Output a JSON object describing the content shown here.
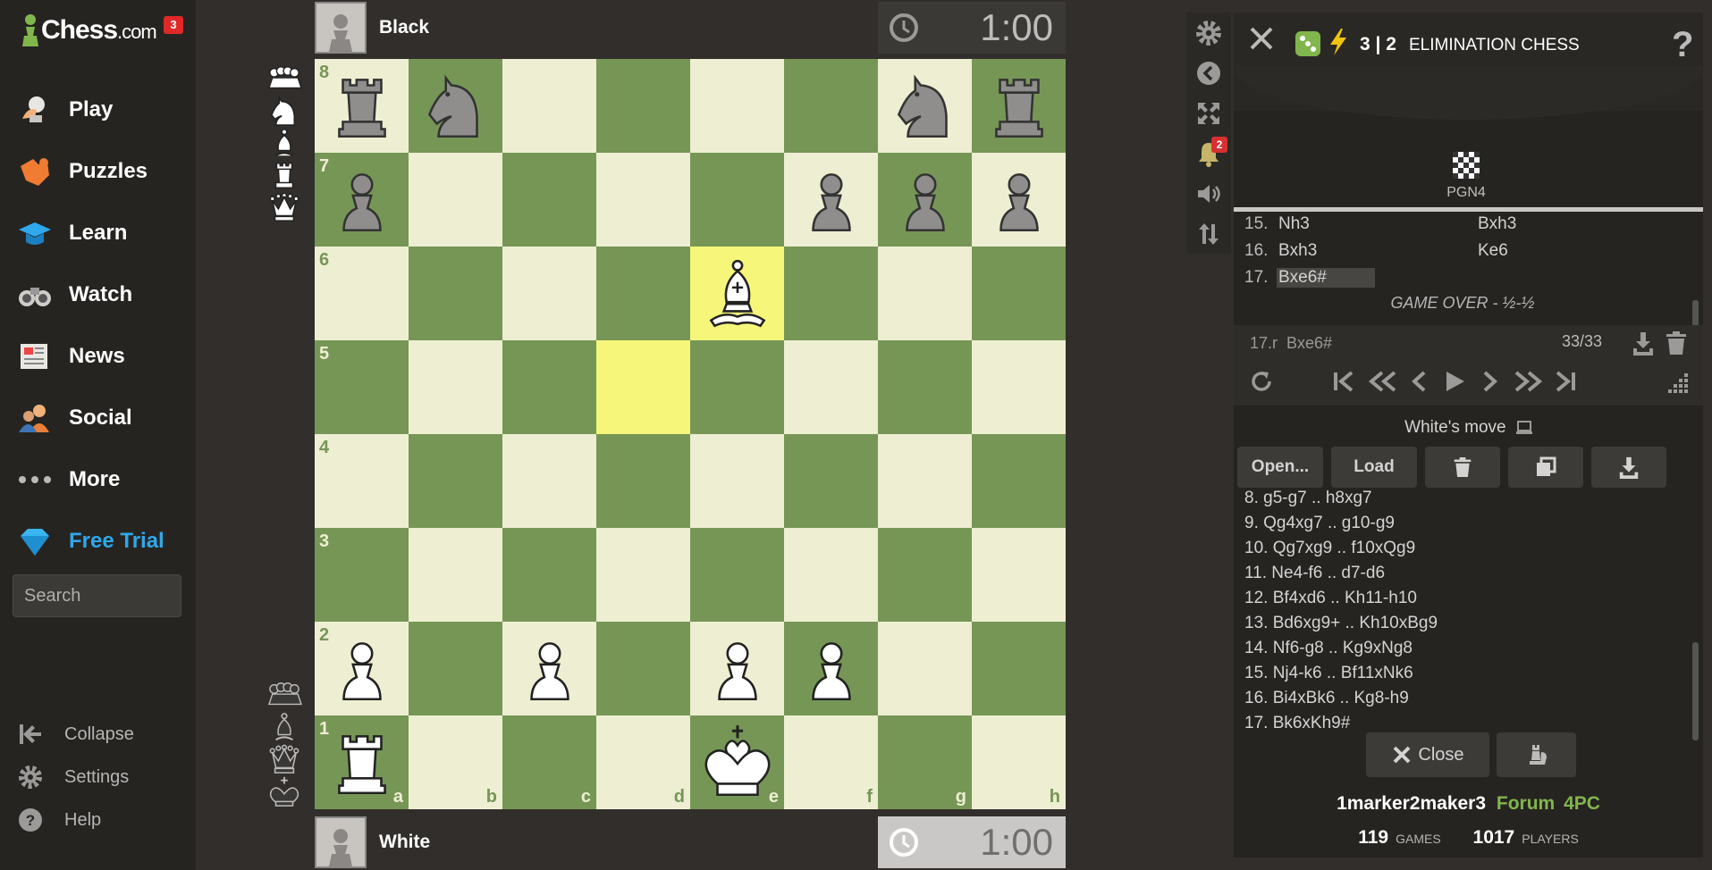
{
  "brand": {
    "name": "Chess",
    "suffix": ".com",
    "badge": "3"
  },
  "nav": [
    {
      "id": "play",
      "label": "Play",
      "icon": "play-hand-icon"
    },
    {
      "id": "puzzles",
      "label": "Puzzles",
      "icon": "puzzle-icon"
    },
    {
      "id": "learn",
      "label": "Learn",
      "icon": "graduation-cap-icon"
    },
    {
      "id": "watch",
      "label": "Watch",
      "icon": "binoculars-icon"
    },
    {
      "id": "news",
      "label": "News",
      "icon": "newspaper-icon"
    },
    {
      "id": "social",
      "label": "Social",
      "icon": "people-icon"
    },
    {
      "id": "more",
      "label": "More",
      "icon": "ellipsis-icon"
    },
    {
      "id": "free-trial",
      "label": "Free Trial",
      "icon": "diamond-icon"
    }
  ],
  "search": {
    "placeholder": "Search"
  },
  "bottom_nav": [
    {
      "id": "collapse",
      "label": "Collapse"
    },
    {
      "id": "settings",
      "label": "Settings"
    },
    {
      "id": "help",
      "label": "Help"
    }
  ],
  "players": {
    "top": {
      "name": "Black",
      "clock": "1:00"
    },
    "bottom": {
      "name": "White",
      "clock": "1:00"
    }
  },
  "board": {
    "ranks": [
      "8",
      "7",
      "6",
      "5",
      "4",
      "3",
      "2",
      "1"
    ],
    "files": [
      "a",
      "b",
      "c",
      "d",
      "e",
      "f",
      "g",
      "h"
    ],
    "highlight_squares": [
      "e6",
      "d5"
    ],
    "pieces": [
      {
        "sq": "a8",
        "p": "bR"
      },
      {
        "sq": "b8",
        "p": "bN"
      },
      {
        "sq": "g8",
        "p": "bN"
      },
      {
        "sq": "h8",
        "p": "bR"
      },
      {
        "sq": "a7",
        "p": "bP"
      },
      {
        "sq": "f7",
        "p": "bP"
      },
      {
        "sq": "g7",
        "p": "bP"
      },
      {
        "sq": "h7",
        "p": "bP"
      },
      {
        "sq": "e6",
        "p": "wB"
      },
      {
        "sq": "a2",
        "p": "wP"
      },
      {
        "sq": "c2",
        "p": "wP"
      },
      {
        "sq": "e2",
        "p": "wP"
      },
      {
        "sq": "f2",
        "p": "wP"
      },
      {
        "sq": "a1",
        "p": "wR"
      },
      {
        "sq": "e1",
        "p": "wK"
      }
    ]
  },
  "captured": {
    "top": [
      "pawns-group",
      "knight",
      "bishop",
      "rook",
      "queen"
    ],
    "bottom": [
      "pawns-group",
      "bishop",
      "queen",
      "king"
    ]
  },
  "panel": {
    "mode_time": "3 | 2",
    "mode_name": "ELIMINATION CHESS",
    "help": "?",
    "tab_label": "PGN4",
    "moves_top": [
      {
        "num": "15.",
        "w": "Nh3",
        "b": "Bxh3"
      },
      {
        "num": "16.",
        "w": "Bxh3",
        "b": "Ke6"
      },
      {
        "num": "17.",
        "w": "Bxe6#",
        "b": ""
      }
    ],
    "game_over": "GAME OVER - ½-½",
    "current_move_num": "17.r",
    "current_move": "Bxe6#",
    "move_count": "33/33",
    "whites_move": "White's move",
    "buttons": {
      "open": "Open...",
      "load": "Load"
    },
    "moves_list": [
      "8. g5-g7 .. h8xg7",
      "9. Qg4xg7 .. g10-g9",
      "10. Qg7xg9 .. f10xQg9",
      "11. Ne4-f6 .. d7-d6",
      "12. Bf4xd6 .. Kh11-h10",
      "13. Bd6xg9+ .. Kh10xBg9",
      "14. Nf6-g8 .. Kg9xNg8",
      "15. Nj4-k6 .. Bf11xNk6",
      "16. Bi4xBk6 .. Kg8-h9",
      "17. Bk6xKh9#"
    ],
    "close_label": "Close",
    "creator": "1marker2maker3",
    "forum_label": "Forum",
    "forum_tag": "4PC",
    "games_count": "119",
    "games_label": "GAMES",
    "players_count": "1017",
    "players_label": "PLAYERS"
  },
  "tools": [
    {
      "id": "settings",
      "icon": "gear-icon"
    },
    {
      "id": "back",
      "icon": "back-arrow-icon"
    },
    {
      "id": "fullscreen",
      "icon": "fullscreen-icon"
    },
    {
      "id": "notifications",
      "icon": "bell-icon",
      "badge": "2"
    },
    {
      "id": "sound",
      "icon": "speaker-icon"
    },
    {
      "id": "flip",
      "icon": "flip-board-icon"
    }
  ],
  "colors": {
    "light_square": "#eeeed2",
    "dark_square": "#769656",
    "highlight": "#f6f67a",
    "accent_blue": "#2fa8ec",
    "forum_green": "#81b64c"
  }
}
